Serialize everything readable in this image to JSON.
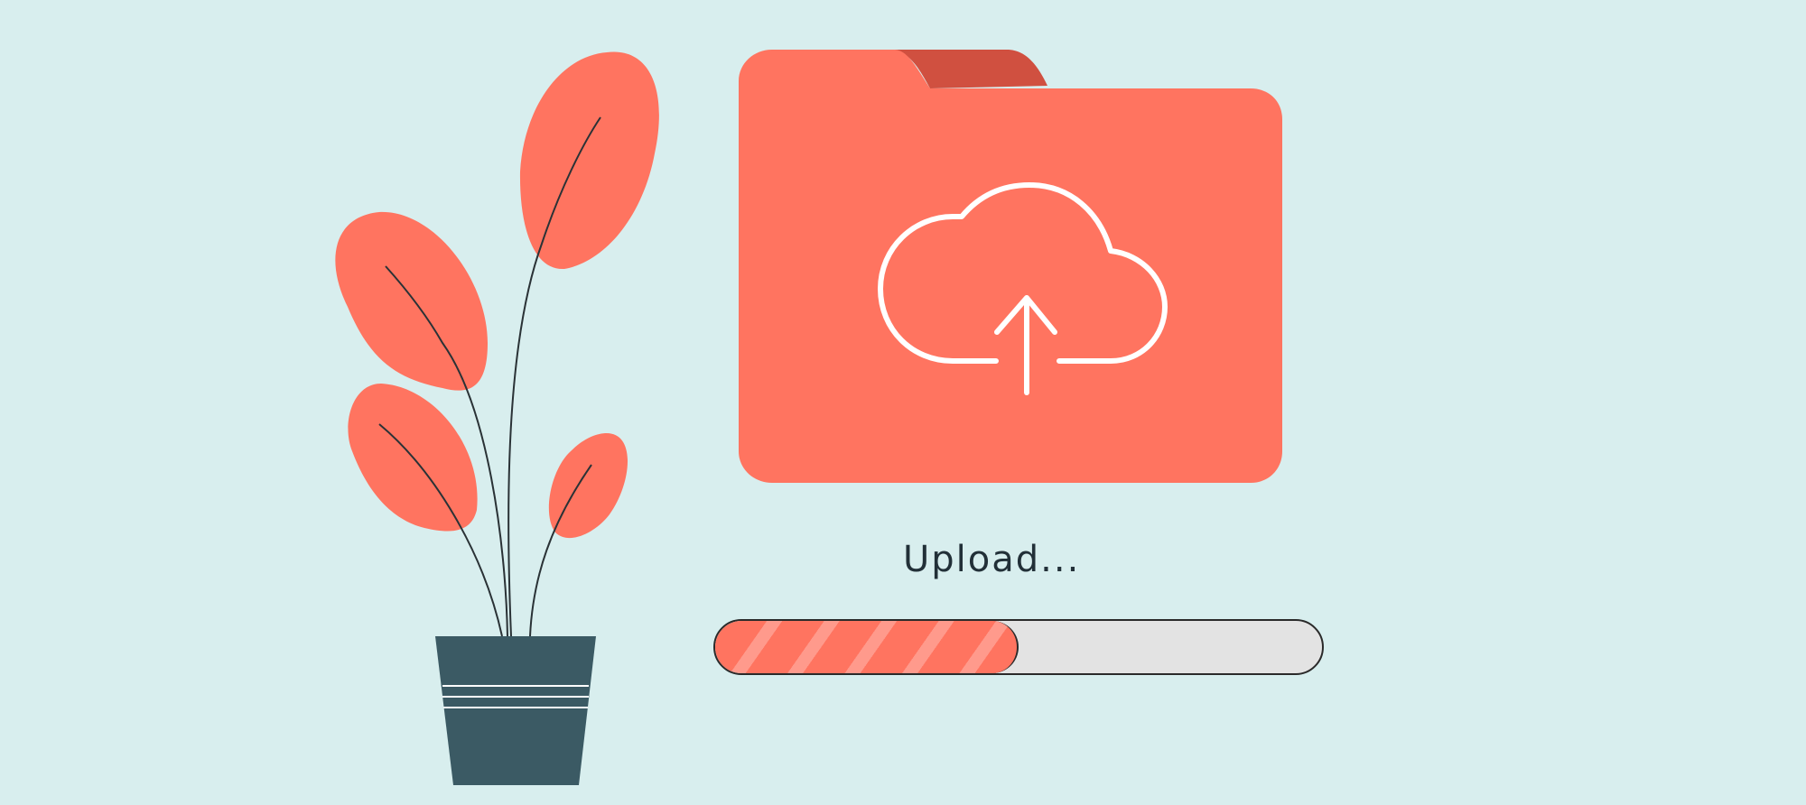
{
  "upload": {
    "label": "Upload...",
    "progress": 0.5
  },
  "colors": {
    "background": "#d8eeee",
    "accent": "#ff7460",
    "accent_dark": "#d05040",
    "accent_stripe": "#ff9a8c",
    "pot": "#3b5a64",
    "track": "#e3e3e3",
    "text": "#223038"
  },
  "icons": {
    "folder": "folder-icon",
    "cloud_upload": "cloud-upload-icon",
    "plant": "potted-plant-illustration"
  }
}
